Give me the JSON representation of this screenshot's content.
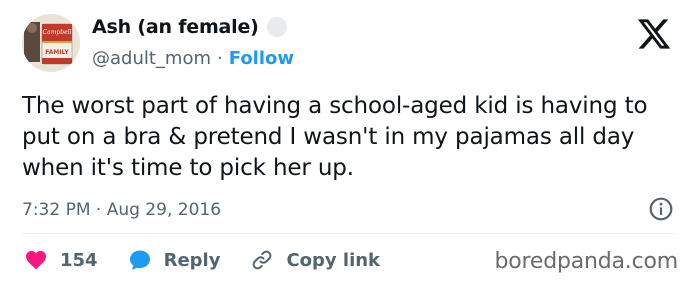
{
  "author": {
    "name": "Ash (an female)",
    "handle": "@adult_mom",
    "separator": "·",
    "follow_label": "Follow"
  },
  "avatar": {
    "icon": "soup-can-avatar",
    "can_text": "FAMILY"
  },
  "tweet": {
    "text": "The worst part of having a school-aged kid is having to put on a bra & pretend I wasn't in my pajamas all day when it's time to pick her up.",
    "timestamp": "7:32 PM · Aug 29, 2016"
  },
  "actions": {
    "like_count": "154",
    "reply_label": "Reply",
    "copy_link_label": "Copy link"
  },
  "icons": {
    "logo": "x-logo-icon",
    "info": "info-icon",
    "like": "heart-icon",
    "reply": "speech-bubble-icon",
    "link": "link-icon"
  },
  "colors": {
    "follow": "#1d9bf0",
    "heart": "#f91880",
    "reply": "#1d9bf0",
    "muted": "#536471"
  },
  "watermark": "boredpanda.com"
}
